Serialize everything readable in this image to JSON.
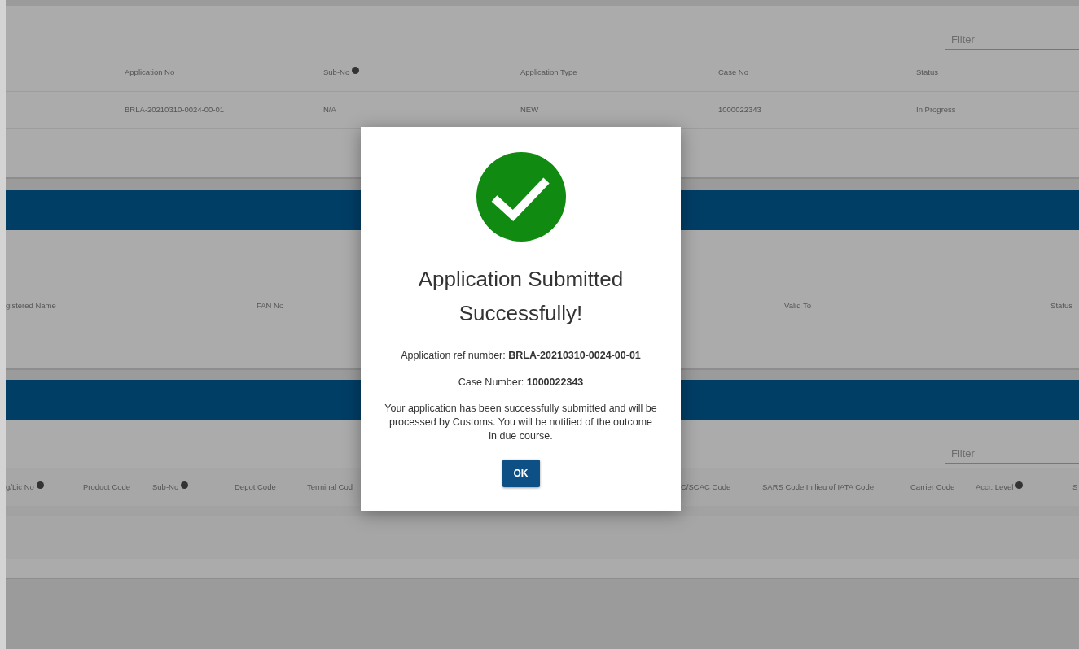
{
  "applications_table": {
    "filter": {
      "placeholder": "Filter"
    },
    "columns": [
      {
        "label": "Application No",
        "info": false
      },
      {
        "label": "Sub-No",
        "info": true
      },
      {
        "label": "Application Type",
        "info": false
      },
      {
        "label": "Case No",
        "info": false
      },
      {
        "label": "Status",
        "info": false
      }
    ],
    "rows": [
      [
        "BRLA-20210310-0024-00-01",
        "N/A",
        "NEW",
        "1000022343",
        "In Progress"
      ]
    ]
  },
  "registrations_table": {
    "columns": [
      {
        "label": "gistered Name",
        "info": false
      },
      {
        "label": "FAN No",
        "info": false
      },
      {
        "label": "Valid To",
        "info": false
      },
      {
        "label": "Status",
        "info": false
      }
    ]
  },
  "accreditations_table": {
    "filter": {
      "placeholder": "Filter"
    },
    "columns": [
      {
        "label": "g/Lic No",
        "info": true
      },
      {
        "label": "Product Code",
        "info": false
      },
      {
        "label": "Sub-No",
        "info": true
      },
      {
        "label": "Depot Code",
        "info": false
      },
      {
        "label": "Terminal Cod",
        "info": false
      },
      {
        "label": "C/SCAC Code",
        "info": false
      },
      {
        "label": "SARS Code In lieu of IATA Code",
        "info": false
      },
      {
        "label": "Carrier Code",
        "info": false
      },
      {
        "label": "Accr. Level",
        "info": true
      },
      {
        "label": "S",
        "info": false
      }
    ]
  },
  "modal": {
    "title": "Application Submitted Successfully!",
    "details": [
      "Application ref number: **BRLA-20210310-0024-00-01**",
      "Case Number: **1000022343**"
    ],
    "message": "Your application has been successfully submitted and will be processed by Customs. You will be notified of the outcome in due course.",
    "button": "OK"
  }
}
